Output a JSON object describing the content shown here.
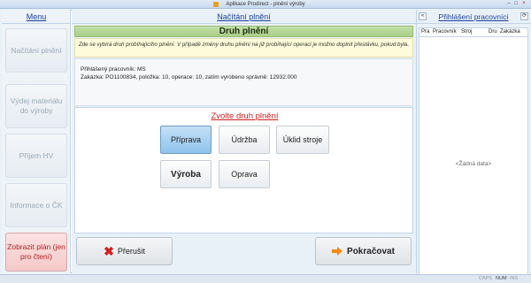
{
  "window": {
    "title": "Aplikace Prodirect - plnění výroby",
    "min": "–",
    "max": "□",
    "close": "×"
  },
  "sidebar": {
    "title": "Menu",
    "items": [
      {
        "label": "Načítání plnění"
      },
      {
        "label": "Výdej materiálu do výroby"
      },
      {
        "label": "Příjem HV"
      },
      {
        "label": "Informace o ČK"
      },
      {
        "label": "Zobrazit plán (jen pro čtení)"
      }
    ]
  },
  "main": {
    "title": "Načítání plnění",
    "section_title": "Druh plnění",
    "note": "Zde se vybírá druh probíhajícího plnění. V případě změny druhu plnění na již probíhající operaci je možno doplnit přestávku, pokud byla.",
    "worker_line": "Přihlášený pracovník: MS",
    "order_line": "Zakázka: PO1100834, položka: 10, operace: 10, zatím vyrobeno správně: 12932.000",
    "choose_title": "Zvolte druh plnění",
    "options": {
      "priprava": "Příprava",
      "udrzba": "Údržba",
      "uklid": "Úklid stroje",
      "vyroba": "Výroba",
      "oprava": "Oprava"
    },
    "cancel": "Přerušit",
    "continue": "Pokračovat"
  },
  "right": {
    "title": "Přihlášení pracovníci",
    "collapse": "«",
    "refresh": "⟳",
    "columns": [
      "Pra",
      "Pracovník",
      "Stroj",
      "Dru",
      "Zakázka"
    ],
    "empty": "<Žádná data>"
  },
  "status": {
    "caps": "CAPS",
    "num": "NUM",
    "ins": "INS"
  }
}
